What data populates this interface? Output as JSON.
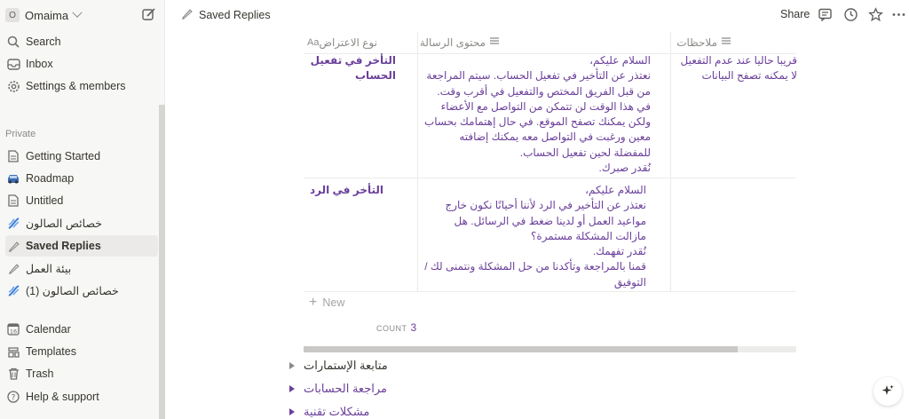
{
  "colors": {
    "accent": "#6a3f9a",
    "sidebar_bg": "#f7f7f5",
    "muted": "#8c8b88"
  },
  "sidebar": {
    "workspace": {
      "avatar": "O",
      "name": "Omaima"
    },
    "top_items": [
      {
        "label": "Search",
        "icon": "search-icon"
      },
      {
        "label": "Inbox",
        "icon": "inbox-icon"
      },
      {
        "label": "Settings & members",
        "icon": "gear-icon"
      }
    ],
    "section_label": "Private",
    "pages": [
      {
        "label": "Getting Started",
        "icon": "page-icon"
      },
      {
        "label": "Roadmap",
        "icon": "car-icon"
      },
      {
        "label": "Untitled",
        "icon": "page-icon"
      },
      {
        "label": "خصائص الصالون",
        "icon": "dna-icon"
      },
      {
        "label": "Saved Replies",
        "icon": "pen-icon",
        "active": true
      },
      {
        "label": "بيئة العمل",
        "icon": "pen-icon"
      },
      {
        "label": "خصائص الصالون (1)",
        "icon": "dna-icon"
      }
    ],
    "bottom_items": [
      {
        "label": "Calendar",
        "icon": "calendar-icon"
      },
      {
        "label": "Templates",
        "icon": "templates-icon"
      },
      {
        "label": "Trash",
        "icon": "trash-icon"
      },
      {
        "label": "Help & support",
        "icon": "help-icon"
      }
    ]
  },
  "topbar": {
    "breadcrumb": "Saved Replies",
    "share_label": "Share"
  },
  "table": {
    "columns": [
      {
        "label": "نوع الاعتراض",
        "icon": "Aa"
      },
      {
        "label": "محتوى الرسالة",
        "icon": "text-lines-icon"
      },
      {
        "label": "ملاحظات",
        "icon": "text-lines-icon"
      }
    ],
    "rows": [
      {
        "title": "التأخر في تفعيل الحساب",
        "message": "السلام عليكم،\nنعتذر عن التأخير في تفعيل الحساب. سيتم المراجعة من قبل الفريق المختص والتفعيل في أقرب وقت.\nفي هذا الوقت لن تتمكن من التواصل مع الأعضاء ولكن يمكنك تصفح الموقع. في حال إهتمامك بحساب معين ورغبت في التواصل معه يمكنك إضافته للمفضلة لحين تفعيل الحساب.\nنُقدر صبرك.",
        "notes": "قريبا حاليا عند عدم التفعيل لا يمكنه تصفح البيانات"
      },
      {
        "title": "التأخر في الرد",
        "message": "السلام عليكم،\nنعتذر عن التأخير في الرد لأننا أحيانًا نكون خارج مواعيد العمل أو لدينا ضغط في الرسائل. هل مازالت المشكلة مستمرة؟\nنُقدر تفهمك.\nقمنا بالمراجعة وتأكدنا من حل المشكلة ونتمنى لك / التوفيق",
        "notes": ""
      }
    ],
    "new_label": "New",
    "count_label": "COUNT",
    "count_value": "3"
  },
  "toggles": [
    {
      "label": "متابعة الإستمارات",
      "color": "#8c8b88"
    },
    {
      "label": "مراجعة الحسابات",
      "color": "#6a3f9a"
    },
    {
      "label": "مشكلات تقنية",
      "color": "#6a3f9a"
    }
  ]
}
